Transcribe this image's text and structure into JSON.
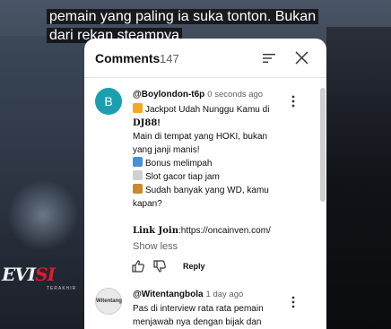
{
  "video": {
    "subtitle_lines": [
      "pemain yang paling ia suka tonton. Bukan",
      "dari rekan steampya"
    ],
    "channel_logo_prefix": "EVI",
    "channel_logo_accent": "SI",
    "channel_logo_sub": "TERAKHIR"
  },
  "panel": {
    "title": "Comments",
    "count": "147"
  },
  "icons": {
    "sort": "sort-icon",
    "close": "close-icon",
    "more": "more-vert-icon",
    "like": "thumb-up-icon",
    "dislike": "thumb-down-icon"
  },
  "comments": [
    {
      "avatar_letter": "B",
      "avatar_color": "#1a9fae",
      "author": "@Boylondon-t6p",
      "time": "0 seconds ago",
      "lines": {
        "l1": "Jackpot Udah Nunggu Kamu di",
        "l2a": "DJ88",
        "l2b": "!",
        "l3": "Main di tempat yang HOKI, bukan",
        "l4": "yang janji manis!",
        "l5": "Bonus melimpah",
        "l6": "Slot gacor tiap jam",
        "l7": "Sudah banyak yang WD, kamu",
        "l8": "kapan?",
        "l9a": "Link Join",
        "l9b": ":https://oncainven.com/"
      },
      "show_less": "Show less",
      "reply": "Reply"
    },
    {
      "avatar_text": "Witentang",
      "author": "@Witentangbola",
      "time": "1 day ago",
      "lines": {
        "l1": "Pas di interview rata rata pemain",
        "l2": "menjawab nya dengan bijak dan"
      }
    }
  ],
  "colors": {
    "avatar_b": "#1a9fae",
    "emoji_explosion": "#f5a623",
    "emoji_gift": "#4a90d9",
    "emoji_chart": "#d0d0d0",
    "emoji_moneybag": "#c98a2b"
  }
}
